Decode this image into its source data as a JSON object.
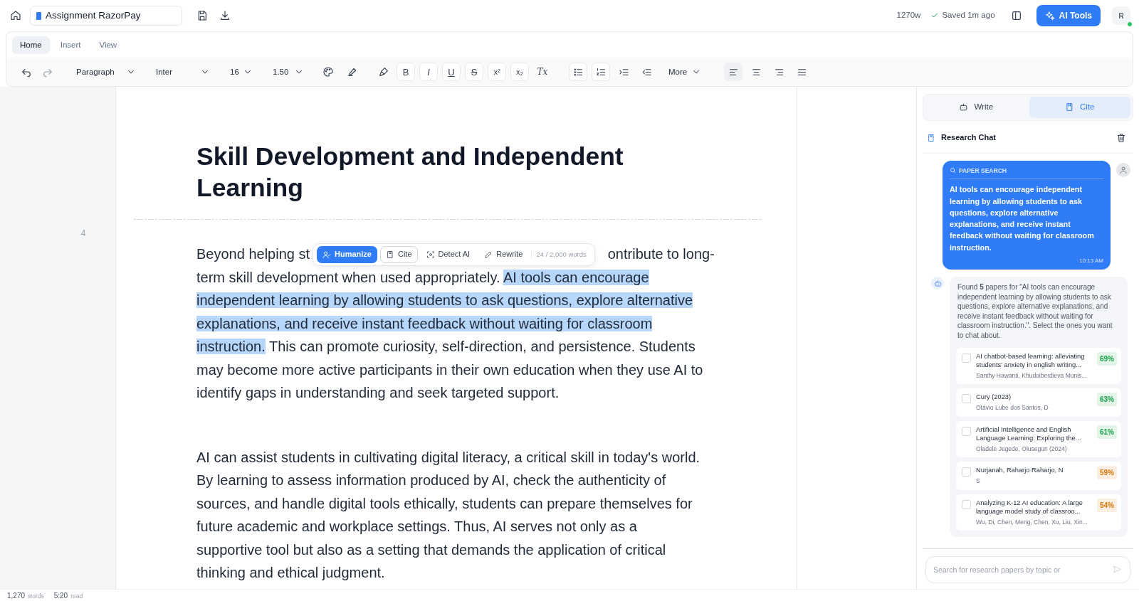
{
  "header": {
    "doc_title": "Assignment RazorPay",
    "word_count": "1270w",
    "save_status": "Saved 1m ago",
    "ai_button": "AI Tools",
    "avatar": {
      "initial": "R",
      "online": true
    }
  },
  "ribbon_tabs": [
    {
      "label": "Home",
      "selected": true
    },
    {
      "label": "Insert",
      "selected": false
    },
    {
      "label": "View",
      "selected": false
    }
  ],
  "toolbar": {
    "selects": [
      "Paragraph",
      "Inter",
      "16",
      "1.50"
    ],
    "format_buttons": [
      "B",
      "I",
      "U",
      "S",
      "x²",
      "x₂",
      "Tx"
    ],
    "more": "More",
    "align": [
      {
        "selected": true
      },
      {
        "selected": false
      },
      {
        "selected": false
      },
      {
        "selected": false
      }
    ]
  },
  "gutter_number": "4",
  "document": {
    "heading": "Skill Development and Independent Learning",
    "paragraph_1": {
      "line_fragments": [
        "Beyond helping st",
        "ontribute to long-"
      ],
      "text_before": "term skill development when used appropriately. ",
      "selected_text": "AI tools can encourage independent learning by allowing students to ask questions, explore alternative explanations, and receive instant feedback without waiting for classroom instruction.",
      "text_after": " This can promote curiosity, self-direction, and persistence. Students may become more active participants in their own education when they use AI to identify gaps in understanding and seek targeted support."
    },
    "paragraph_2": "AI can assist students in cultivating digital literacy, a critical skill in today's world. By learning to assess information produced by AI, check the authenticity of sources, and handle digital tools ethically, students can prepare themselves for future academic and workplace settings. Thus, AI serves not only as a supportive tool but also as a setting that demands the application of critical thinking and ethical judgment."
  },
  "floating_toolbar": {
    "buttons": [
      {
        "label": "Humanize",
        "kind": "primary"
      },
      {
        "label": "Cite",
        "kind": "outline"
      },
      {
        "label": "Detect AI",
        "kind": "plain"
      },
      {
        "label": "Rewrite",
        "kind": "plain"
      }
    ],
    "count": "24 / 2,000 words"
  },
  "panel": {
    "tabs": [
      {
        "label": "Write",
        "selected": false
      },
      {
        "label": "Cite",
        "selected": true
      }
    ],
    "chat_title": "Research Chat",
    "user_message": {
      "label": "PAPER SEARCH",
      "text": "AI tools can encourage independent learning by allowing students to ask questions, explore alternative explanations, and receive instant feedback without waiting for classroom instruction.",
      "time": "10:13 AM"
    },
    "bot_message": "Found **5** papers for \"AI tools can encourage independent learning by allowing students to ask questions, explore alternative explanations, and receive instant feedback without waiting for classroom instruction.\". Select the ones you want to chat about.",
    "papers": [
      {
        "title": "AI chatbot-based learning: alleviating students' anxiety in english writing...",
        "authors": "Santhy Hawanti, Khudoiberdieva Munis...",
        "score": "69%",
        "color": "#16a34a",
        "checked": false
      },
      {
        "title": "Cury (2023)",
        "authors": "Otávio Lube dos Santos, D",
        "score": "63%",
        "color": "#16a34a",
        "checked": false
      },
      {
        "title": "Artificial Intelligence and English Language Learning: Exploring the...",
        "authors": "Oladele Jegede, Olusegun (2024)",
        "score": "61%",
        "color": "#16a34a",
        "checked": false
      },
      {
        "title": "Nurjanah, Raharjo Raharjo, N",
        "authors": "S",
        "score": "59%",
        "color": "#d97706",
        "checked": false
      },
      {
        "title": "Analyzing K-12 AI education: A large language model study of classroo...",
        "authors": "Wu, Di, Chen, Meng, Chen, Xu, Liu, Xin...",
        "score": "54%",
        "color": "#d97706",
        "checked": false
      }
    ],
    "search": {
      "placeholder": "Search for research papers by topic or"
    }
  },
  "status_bar": [
    {
      "value": "1,270",
      "unit": "words"
    },
    {
      "value": "5:20",
      "unit": "read"
    }
  ]
}
